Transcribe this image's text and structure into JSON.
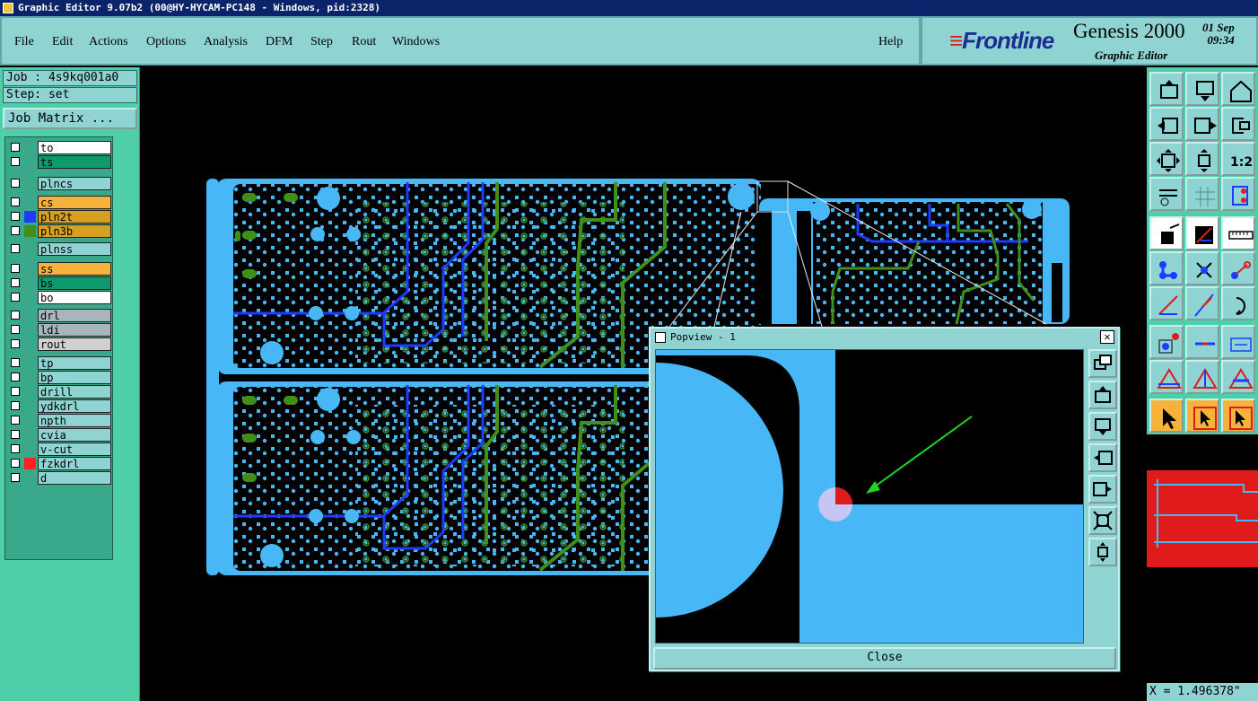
{
  "window": {
    "title": "Graphic Editor 9.07b2 (00@HY-HYCAM-PC148 - Windows, pid:2328)"
  },
  "menubar": {
    "items": [
      "File",
      "Edit",
      "Actions",
      "Options",
      "Analysis",
      "DFM",
      "Step",
      "Rout",
      "Windows"
    ],
    "help": "Help"
  },
  "brand": {
    "logo": "Frontline",
    "product": "Genesis 2000",
    "subtitle": "Graphic Editor",
    "date": "01 Sep",
    "time": "09:34"
  },
  "job": {
    "job_label": "Job : 4s9kq001a0",
    "step_label": "Step: set",
    "matrix_button": "Job Matrix ..."
  },
  "layers": [
    {
      "name": "to",
      "color": "#ffffff",
      "swatch": ""
    },
    {
      "name": "ts",
      "color": "#0f9a6e",
      "swatch": ""
    },
    {
      "name": "plncs",
      "color": "#8fd3d3",
      "swatch": ""
    },
    {
      "name": "cs",
      "color": "#f5b33c",
      "swatch": ""
    },
    {
      "name": "pln2t",
      "color": "#d8a020",
      "swatch": "#1e3cff"
    },
    {
      "name": "pln3b",
      "color": "#d8a020",
      "swatch": "#3f8f1a"
    },
    {
      "name": "plnss",
      "color": "#8fd3d3",
      "swatch": ""
    },
    {
      "name": "ss",
      "color": "#f5b33c",
      "swatch": ""
    },
    {
      "name": "bs",
      "color": "#0f9a6e",
      "swatch": ""
    },
    {
      "name": "bo",
      "color": "#ffffff",
      "swatch": ""
    },
    {
      "name": "drl",
      "color": "#a9b5bd",
      "swatch": ""
    },
    {
      "name": "ldi",
      "color": "#a9b5bd",
      "swatch": ""
    },
    {
      "name": "rout",
      "color": "#d0d0d0",
      "swatch": ""
    },
    {
      "name": "tp",
      "color": "#8fd3d3",
      "swatch": ""
    },
    {
      "name": "bp",
      "color": "#8fd3d3",
      "swatch": ""
    },
    {
      "name": "drill",
      "color": "#8fd3d3",
      "swatch": ""
    },
    {
      "name": "ydkdrl",
      "color": "#8fd3d3",
      "swatch": ""
    },
    {
      "name": "npth",
      "color": "#8fd3d3",
      "swatch": ""
    },
    {
      "name": "cvia",
      "color": "#8fd3d3",
      "swatch": ""
    },
    {
      "name": "v-cut",
      "color": "#8fd3d3",
      "swatch": ""
    },
    {
      "name": "fzkdrl",
      "color": "#8fd3d3",
      "swatch": "#ff2020"
    },
    {
      "name": "d",
      "color": "#8fd3d3",
      "swatch": ""
    }
  ],
  "toolbar": {
    "icons": [
      "zoom-in-icon",
      "zoom-out-icon",
      "home-icon",
      "pan-left-icon",
      "pan-right-icon",
      "undo-zoom-icon",
      "fit-frame-icon",
      "fit-center-icon",
      "scale-1to1-icon",
      "snap-tools-icon",
      "grid-icon",
      "layer-display-icon",
      "feature-select-icon",
      "measure-line-icon",
      "ruler-icon",
      "net-connect-icon",
      "cross-select-icon",
      "point-select-icon",
      "line-draw-icon",
      "slash-draw-icon",
      "arc-rotate-icon",
      "pad-select-icon",
      "segment-icon",
      "dimension-icon",
      "triangle-a-icon",
      "triangle-b-icon",
      "triangle-c-icon",
      "pointer-icon",
      "pointer-box-icon",
      "pointer-box-2-icon"
    ],
    "scale_label": "1:2"
  },
  "status": {
    "coord": "X = 1.496378\""
  },
  "popview": {
    "title": "Popview - 1",
    "close_x": "✕",
    "close_button": "Close",
    "side_icons": [
      "copy-view-icon",
      "zoom-in-icon",
      "zoom-out-icon",
      "pan-left-icon",
      "pan-right-icon",
      "fit-icon",
      "center-icon"
    ]
  },
  "colors": {
    "copper": "#47b8f5",
    "trace_blue": "#1e3cff",
    "trace_green": "#3f8f1a",
    "accent_red": "#e01b1b",
    "arrow_green": "#1ed81e"
  }
}
